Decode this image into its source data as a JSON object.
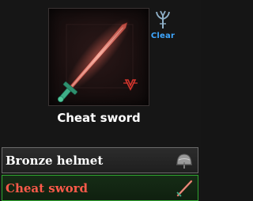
{
  "preview": {
    "item_name": "Cheat sword"
  },
  "clear_button": {
    "label": "Clear",
    "icon": "trident-icon"
  },
  "items": [
    {
      "label": "Bronze helmet",
      "icon": "helmet-icon",
      "selected": false
    },
    {
      "label": "Cheat sword",
      "icon": "sword-icon",
      "selected": true
    }
  ],
  "colors": {
    "clear_text": "#3ea7ff",
    "selected_text": "#ff5a4a",
    "selected_border": "#2fa62f",
    "normal_text": "#ffffff"
  }
}
